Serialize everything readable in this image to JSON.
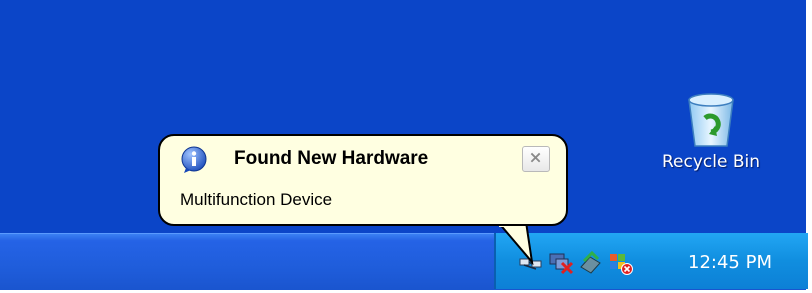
{
  "desktop": {
    "recycle_bin": {
      "label": "Recycle Bin",
      "icon": "recycle-bin-icon"
    }
  },
  "balloon": {
    "icon": "info-icon",
    "title": "Found New Hardware",
    "message": "Multifunction Device",
    "close_icon": "close-icon",
    "background": "#ffffe1"
  },
  "taskbar": {
    "color": "#1f5ddb",
    "tray": {
      "color": "#108edf",
      "icons": [
        "network-connected-icon",
        "network-disconnected-icon",
        "safely-remove-hardware-icon",
        "network-error-icon"
      ],
      "clock": "12:45 PM"
    }
  }
}
